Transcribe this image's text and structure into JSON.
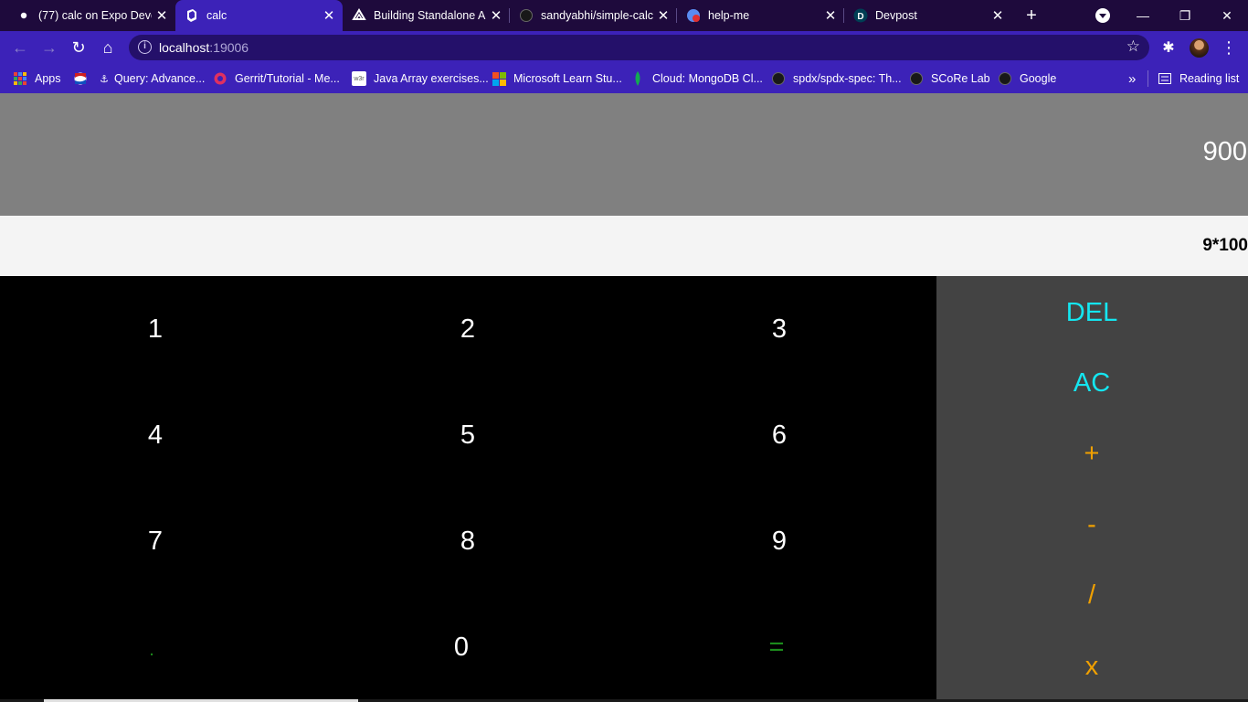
{
  "browser": {
    "tabs": [
      {
        "title": "(77) calc on Expo Deve",
        "icon": "expo-dot-icon"
      },
      {
        "title": "calc",
        "icon": "react-native-icon",
        "active": true
      },
      {
        "title": "Building Standalone A",
        "icon": "expo-icon"
      },
      {
        "title": "sandyabhi/simple-calc",
        "icon": "github-icon"
      },
      {
        "title": "help-me",
        "icon": "notification-icon"
      },
      {
        "title": "Devpost",
        "icon": "devpost-icon"
      }
    ],
    "new_tab": "+",
    "window": {
      "minimize": "—",
      "restore": "❐",
      "close": "✕"
    },
    "address": {
      "host": "localhost",
      "port": ":19006"
    },
    "bookmarks": [
      {
        "label": "Apps"
      },
      {
        "label": ""
      },
      {
        "label": "Query: Advance..."
      },
      {
        "label": "Gerrit/Tutorial - Me..."
      },
      {
        "label": "Java Array exercises..."
      },
      {
        "label": "Microsoft Learn Stu..."
      },
      {
        "label": "Cloud: MongoDB Cl..."
      },
      {
        "label": "spdx/spdx-spec: Th..."
      },
      {
        "label": "SCoRe Lab"
      },
      {
        "label": "Google"
      }
    ],
    "more_bookmarks": "»",
    "reading_list": "Reading list"
  },
  "calculator": {
    "result": "900",
    "expression": "9*100",
    "numbers": [
      {
        "label": "1"
      },
      {
        "label": "2"
      },
      {
        "label": "3"
      },
      {
        "label": "4"
      },
      {
        "label": "5"
      },
      {
        "label": "6"
      },
      {
        "label": "7"
      },
      {
        "label": "8"
      },
      {
        "label": "9"
      },
      {
        "label": "."
      },
      {
        "label": "0"
      },
      {
        "label": "="
      }
    ],
    "operations": [
      {
        "label": "DEL"
      },
      {
        "label": "AC"
      },
      {
        "label": "+"
      },
      {
        "label": "-"
      },
      {
        "label": "/"
      },
      {
        "label": "x"
      }
    ],
    "colors": {
      "result_bg": "#808080",
      "expression_bg": "#f4f4f4",
      "numpad_bg": "#000000",
      "oppad_bg": "#434343",
      "control_text": "#14e6f0",
      "operator_text": "#f0a000",
      "special_key_text": "#1c8c1c"
    }
  }
}
